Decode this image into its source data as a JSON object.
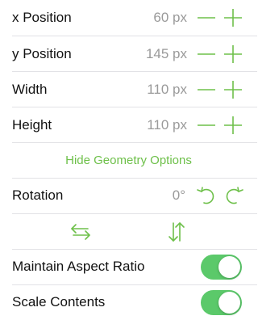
{
  "accent_color": "#6ec04a",
  "toggle_on_color": "#5bc96a",
  "geometry": {
    "x_position": {
      "label": "x Position",
      "value": "60 px"
    },
    "y_position": {
      "label": "y Position",
      "value": "145 px"
    },
    "width": {
      "label": "Width",
      "value": "110 px"
    },
    "height": {
      "label": "Height",
      "value": "110 px"
    },
    "hide_link": "Hide Geometry Options"
  },
  "rotation": {
    "label": "Rotation",
    "value": "0°"
  },
  "icons": {
    "minus": "minus-icon",
    "plus": "plus-icon",
    "rotate_left": "rotate-left-icon",
    "rotate_right": "rotate-right-icon",
    "flip_horizontal": "flip-horizontal-icon",
    "flip_vertical": "flip-vertical-icon"
  },
  "toggles": {
    "maintain_aspect_ratio": {
      "label": "Maintain Aspect Ratio",
      "on": true
    },
    "scale_contents": {
      "label": "Scale Contents",
      "on": true
    }
  }
}
